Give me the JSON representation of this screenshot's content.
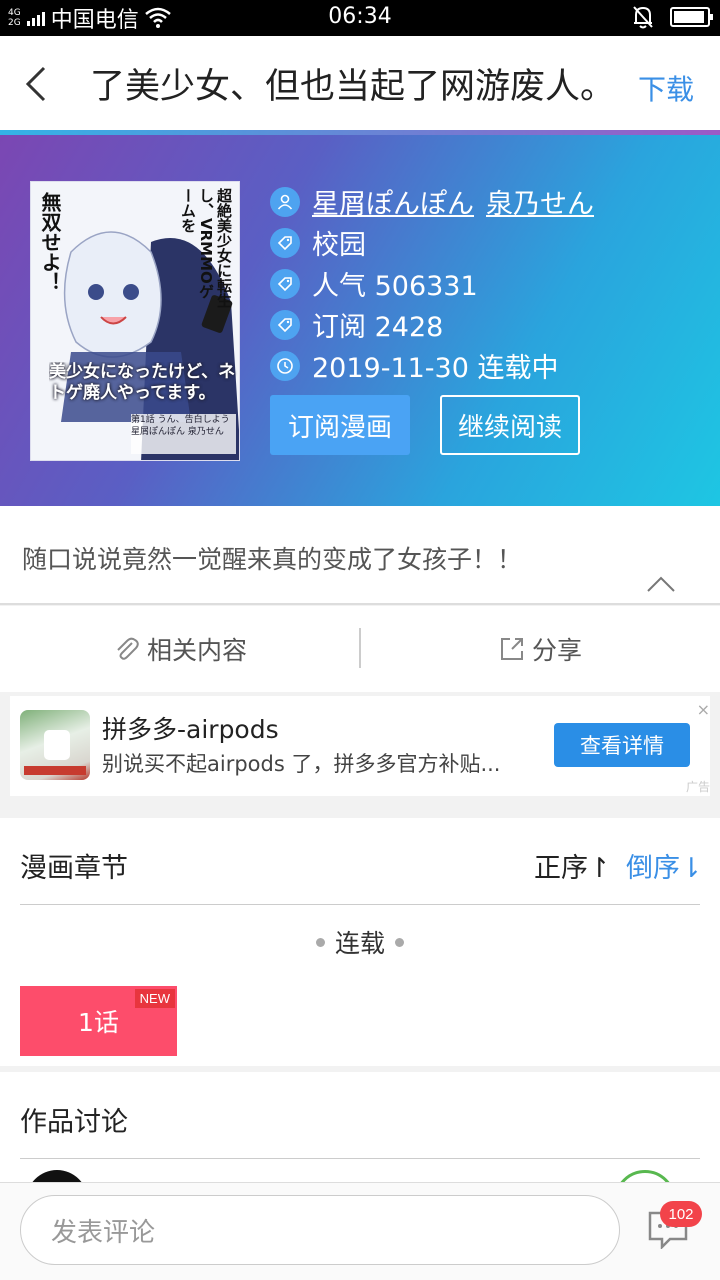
{
  "status_bar": {
    "net_top": "4G",
    "net_bottom": "2G",
    "carrier": "中国电信",
    "time": "06:34",
    "battery_level": 0.95
  },
  "title_bar": {
    "title": "了美少女、但也当起了网游废人。",
    "download_label": "下载"
  },
  "comic": {
    "authors": [
      "星屑ぽんぽん",
      "泉乃せん"
    ],
    "genre": "校园",
    "popularity": "人气 506331",
    "subscriptions": "订阅 2428",
    "date_status": "2019-11-30 连载中",
    "subscribe_label": "订阅漫画",
    "continue_label": "继续阅读",
    "description": "随口说说竟然一觉醒来真的变成了女孩子！！"
  },
  "cover": {
    "lines": [
      "超絶美少女に",
      "転生し、",
      "VRMMO",
      "ゲームを",
      "無双せよ！"
    ],
    "title_jp": "美少女になったけど、ネトゲ廃人やってます。",
    "episode": "第1話 うん、告白しよう",
    "authors": "星屑ぽんぽん 泉乃せん"
  },
  "actions": {
    "related_label": "相关内容",
    "share_label": "分享"
  },
  "ad": {
    "title": "拼多多-airpods",
    "subtitle": "别说买不起airpods 了，拼多多官方补贴...",
    "button_label": "查看详情",
    "close": "×",
    "tag": "广告"
  },
  "chapters": {
    "title": "漫画章节",
    "order_label": "正序↾",
    "reverse_label": "倒序⇂",
    "status_label": "连载",
    "episodes": [
      {
        "label": "1话",
        "badge": "NEW"
      }
    ]
  },
  "discussion": {
    "title": "作品讨论"
  },
  "comment_bar": {
    "placeholder": "发表评论",
    "count": "102"
  },
  "colors": {
    "accent": "#3a8fe6",
    "episode_button": "#fd4d6b",
    "badge": "#e8353e"
  }
}
